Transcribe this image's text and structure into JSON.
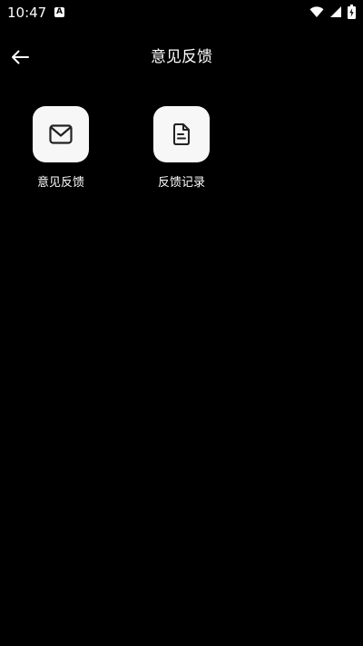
{
  "status_bar": {
    "time": "10:47",
    "notification_icon": "a-badge-icon",
    "wifi_icon": "wifi-icon",
    "signal_icon": "signal-icon",
    "battery_icon": "battery-charging-icon"
  },
  "header": {
    "back_icon": "arrow-left-icon",
    "title": "意见反馈"
  },
  "menu": {
    "items": [
      {
        "label": "意见反馈",
        "icon": "mail-icon"
      },
      {
        "label": "反馈记录",
        "icon": "document-icon"
      }
    ]
  },
  "colors": {
    "background": "#000000",
    "tile": "#f7f7f7",
    "icon": "#222222",
    "text": "#ffffff"
  }
}
